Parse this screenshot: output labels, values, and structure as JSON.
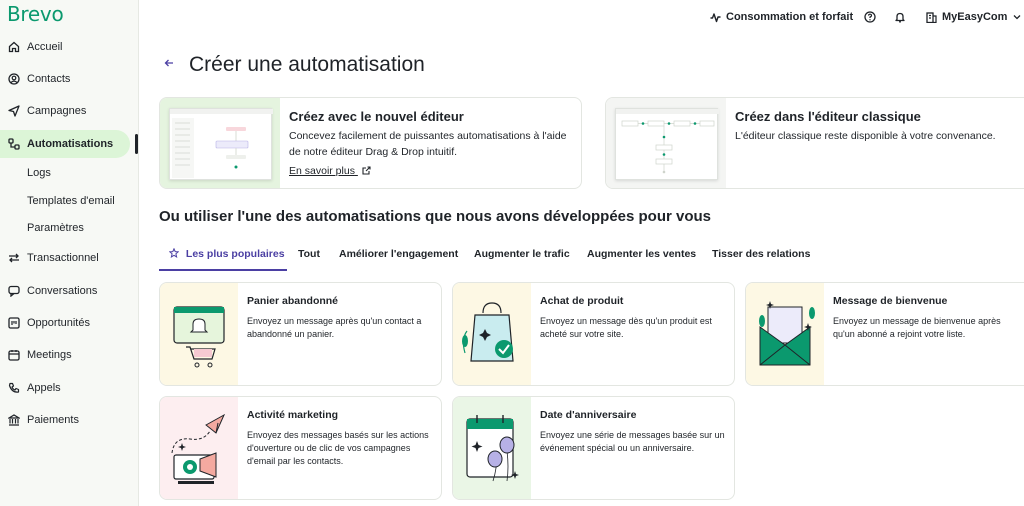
{
  "brand": {
    "logo": "Brevo",
    "accent": "#0b996e",
    "active_bg": "#dcf5d7",
    "tab_color": "#4b3fa3"
  },
  "sidebar": {
    "items": [
      {
        "label": "Accueil",
        "icon": "home-icon"
      },
      {
        "label": "Contacts",
        "icon": "contacts-icon"
      },
      {
        "label": "Campagnes",
        "icon": "send-icon"
      },
      {
        "label": "Automatisations",
        "icon": "automation-icon",
        "active": true
      },
      {
        "label": "Logs"
      },
      {
        "label": "Templates d'email"
      },
      {
        "label": "Paramètres"
      },
      {
        "label": "Transactionnel",
        "icon": "transfer-icon"
      },
      {
        "label": "Conversations",
        "icon": "chat-icon"
      },
      {
        "label": "Opportunités",
        "icon": "deals-icon"
      },
      {
        "label": "Meetings",
        "icon": "calendar-icon"
      },
      {
        "label": "Appels",
        "icon": "phone-icon"
      },
      {
        "label": "Paiements",
        "icon": "bank-icon"
      }
    ]
  },
  "topbar": {
    "usage_label": "Consommation et forfait",
    "account_label": "MyEasyCom"
  },
  "header": {
    "back_icon": "arrow-left-icon",
    "title": "Créer une automatisation"
  },
  "editors": {
    "new": {
      "title": "Créez avec le nouvel éditeur",
      "description": "Concevez facilement de puissantes automatisations à l'aide de notre éditeur Drag & Drop intuitif.",
      "link": "En savoir plus"
    },
    "classic": {
      "title": "Créez dans l'éditeur classique",
      "description": "L'éditeur classique reste disponible à votre convenance."
    }
  },
  "section_title": "Ou utiliser l'une des automatisations que nous avons développées pour vous",
  "tabs": [
    {
      "label": "Les plus populaires",
      "active": true
    },
    {
      "label": "Tout"
    },
    {
      "label": "Améliorer l'engagement"
    },
    {
      "label": "Augmenter le trafic"
    },
    {
      "label": "Augmenter les ventes"
    },
    {
      "label": "Tisser des relations"
    }
  ],
  "automations": [
    {
      "title": "Panier abandonné",
      "description": "Envoyez un message après qu'un contact a abandonné un panier.",
      "icon": "cart-icon",
      "bg": "#fdf8e4"
    },
    {
      "title": "Achat de produit",
      "description": "Envoyez un message dès qu'un produit est acheté sur votre site.",
      "icon": "shopping-bag-icon",
      "bg": "#fdf8e4"
    },
    {
      "title": "Message de bienvenue",
      "description": "Envoyez un message de bienvenue après qu'un abonné a rejoint votre liste.",
      "icon": "envelope-icon",
      "bg": "#fdf8e4"
    },
    {
      "title": "Activité marketing",
      "description": "Envoyez des messages basés sur les actions d'ouverture ou de clic de vos campagnes d'email par les contacts.",
      "icon": "megaphone-icon",
      "bg": "#fdeef0"
    },
    {
      "title": "Date d'anniversaire",
      "description": "Envoyez une série de messages basée sur un événement spécial ou un anniversaire.",
      "icon": "birthday-calendar-icon",
      "bg": "#eaf6e6"
    }
  ]
}
